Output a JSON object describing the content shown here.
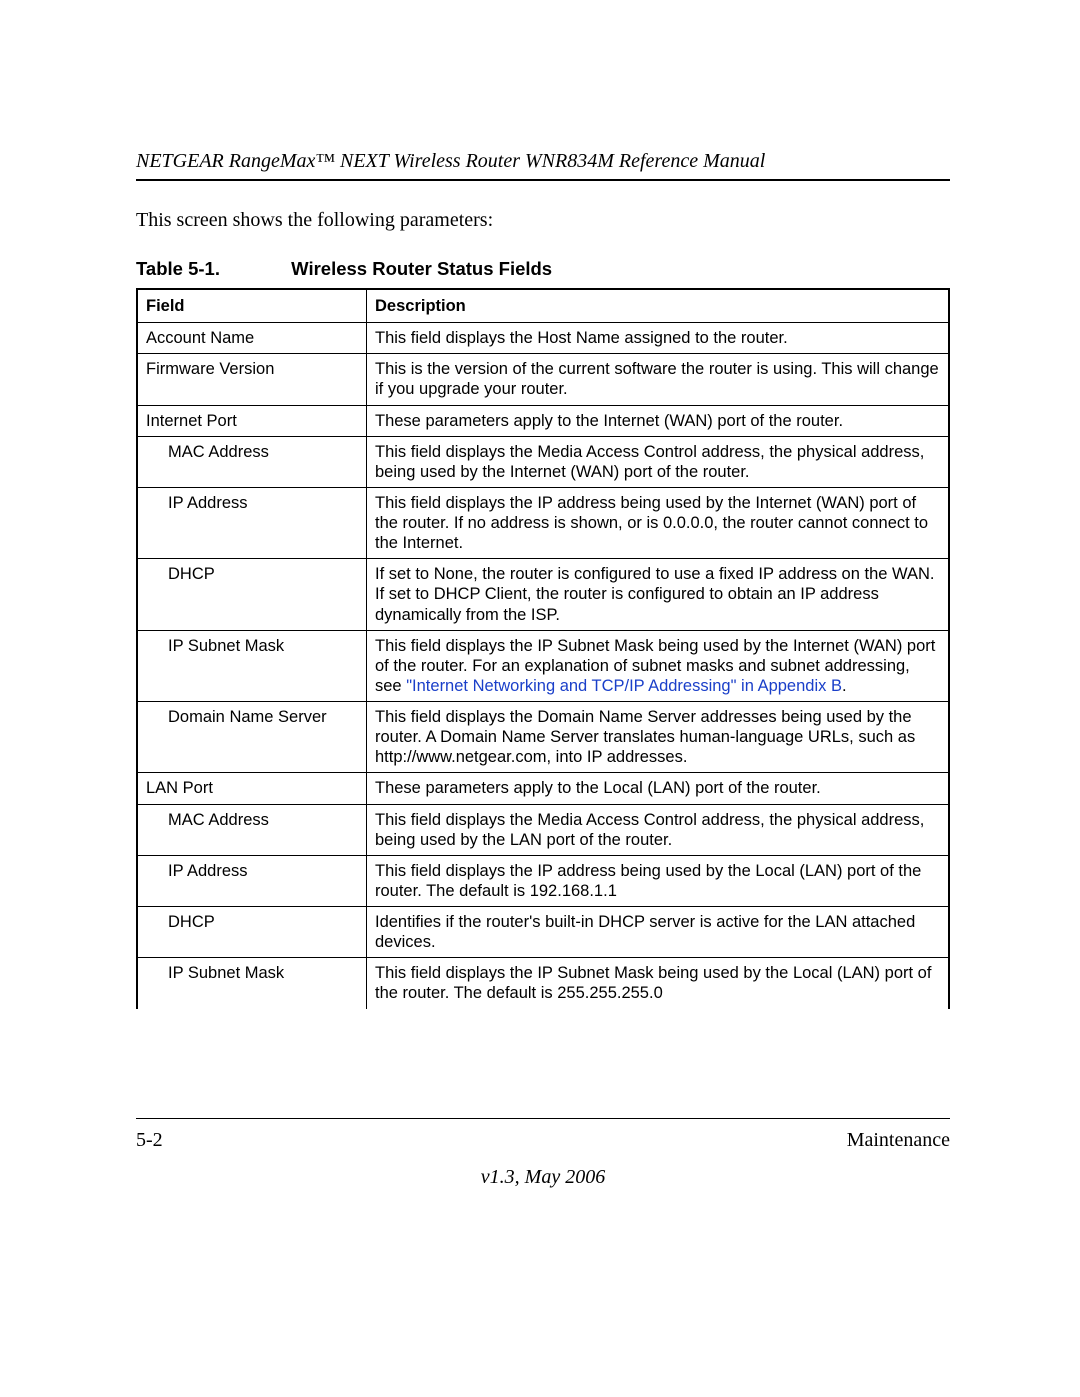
{
  "header": "NETGEAR RangeMax™ NEXT Wireless Router WNR834M Reference Manual",
  "intro": "This screen shows the following parameters:",
  "caption_label": "Table 5-1.",
  "caption_title": "Wireless Router Status Fields",
  "columns": {
    "field": "Field",
    "desc": "Description"
  },
  "rows": [
    {
      "field": "Account Name",
      "indent": false,
      "desc": "This field displays the Host Name assigned to the router."
    },
    {
      "field": "Firmware Version",
      "indent": false,
      "desc": "This is the version of the current software the router is using. This will change if you upgrade your router."
    },
    {
      "field": "Internet Port",
      "indent": false,
      "desc": "These parameters apply to the Internet (WAN) port of the router."
    },
    {
      "field": "MAC Address",
      "indent": true,
      "desc": "This field displays the Media Access Control address, the physical address, being used by the Internet (WAN) port of the router."
    },
    {
      "field": "IP Address",
      "indent": true,
      "desc": "This field displays the IP address being used by the Internet (WAN) port of the router. If no address is shown, or is 0.0.0.0, the router cannot connect to the Internet."
    },
    {
      "field": "DHCP",
      "indent": true,
      "desc_lines": [
        "If set to None, the router is configured to use a fixed IP address on the WAN.",
        "If set to DHCP Client, the router is configured to obtain an IP address dynamically from the ISP."
      ]
    },
    {
      "field": "IP Subnet Mask",
      "indent": true,
      "desc_pre": "This field displays the IP Subnet Mask being used by the Internet (WAN) port of the router. For an explanation of subnet masks and subnet addressing, see ",
      "link1": "\"Internet Networking and TCP/IP Addressing\" in Appendix B",
      "desc_post": "."
    },
    {
      "field": "Domain Name Server",
      "indent": true,
      "desc": "This field displays the Domain Name Server addresses being used by the router. A Domain Name Server translates human-language URLs, such as http://www.netgear.com, into IP addresses."
    },
    {
      "field": "LAN Port",
      "indent": false,
      "desc": "These parameters apply to the Local (LAN) port of the router."
    },
    {
      "field": "MAC Address",
      "indent": true,
      "desc": "This field displays the Media Access Control address, the physical address, being used by the LAN port of the router."
    },
    {
      "field": "IP Address",
      "indent": true,
      "desc": "This field displays the IP address being used by the Local (LAN) port of the router. The default is 192.168.1.1"
    },
    {
      "field": "DHCP",
      "indent": true,
      "desc": "Identifies if the router's built-in DHCP server is active for the LAN attached devices."
    },
    {
      "field": "IP Subnet Mask",
      "indent": true,
      "last": true,
      "desc": "This field displays the IP Subnet Mask being used by the Local (LAN) port of the router. The default is 255.255.255.0"
    }
  ],
  "footer": {
    "page": "5-2",
    "section": "Maintenance",
    "version": "v1.3, May 2006"
  }
}
